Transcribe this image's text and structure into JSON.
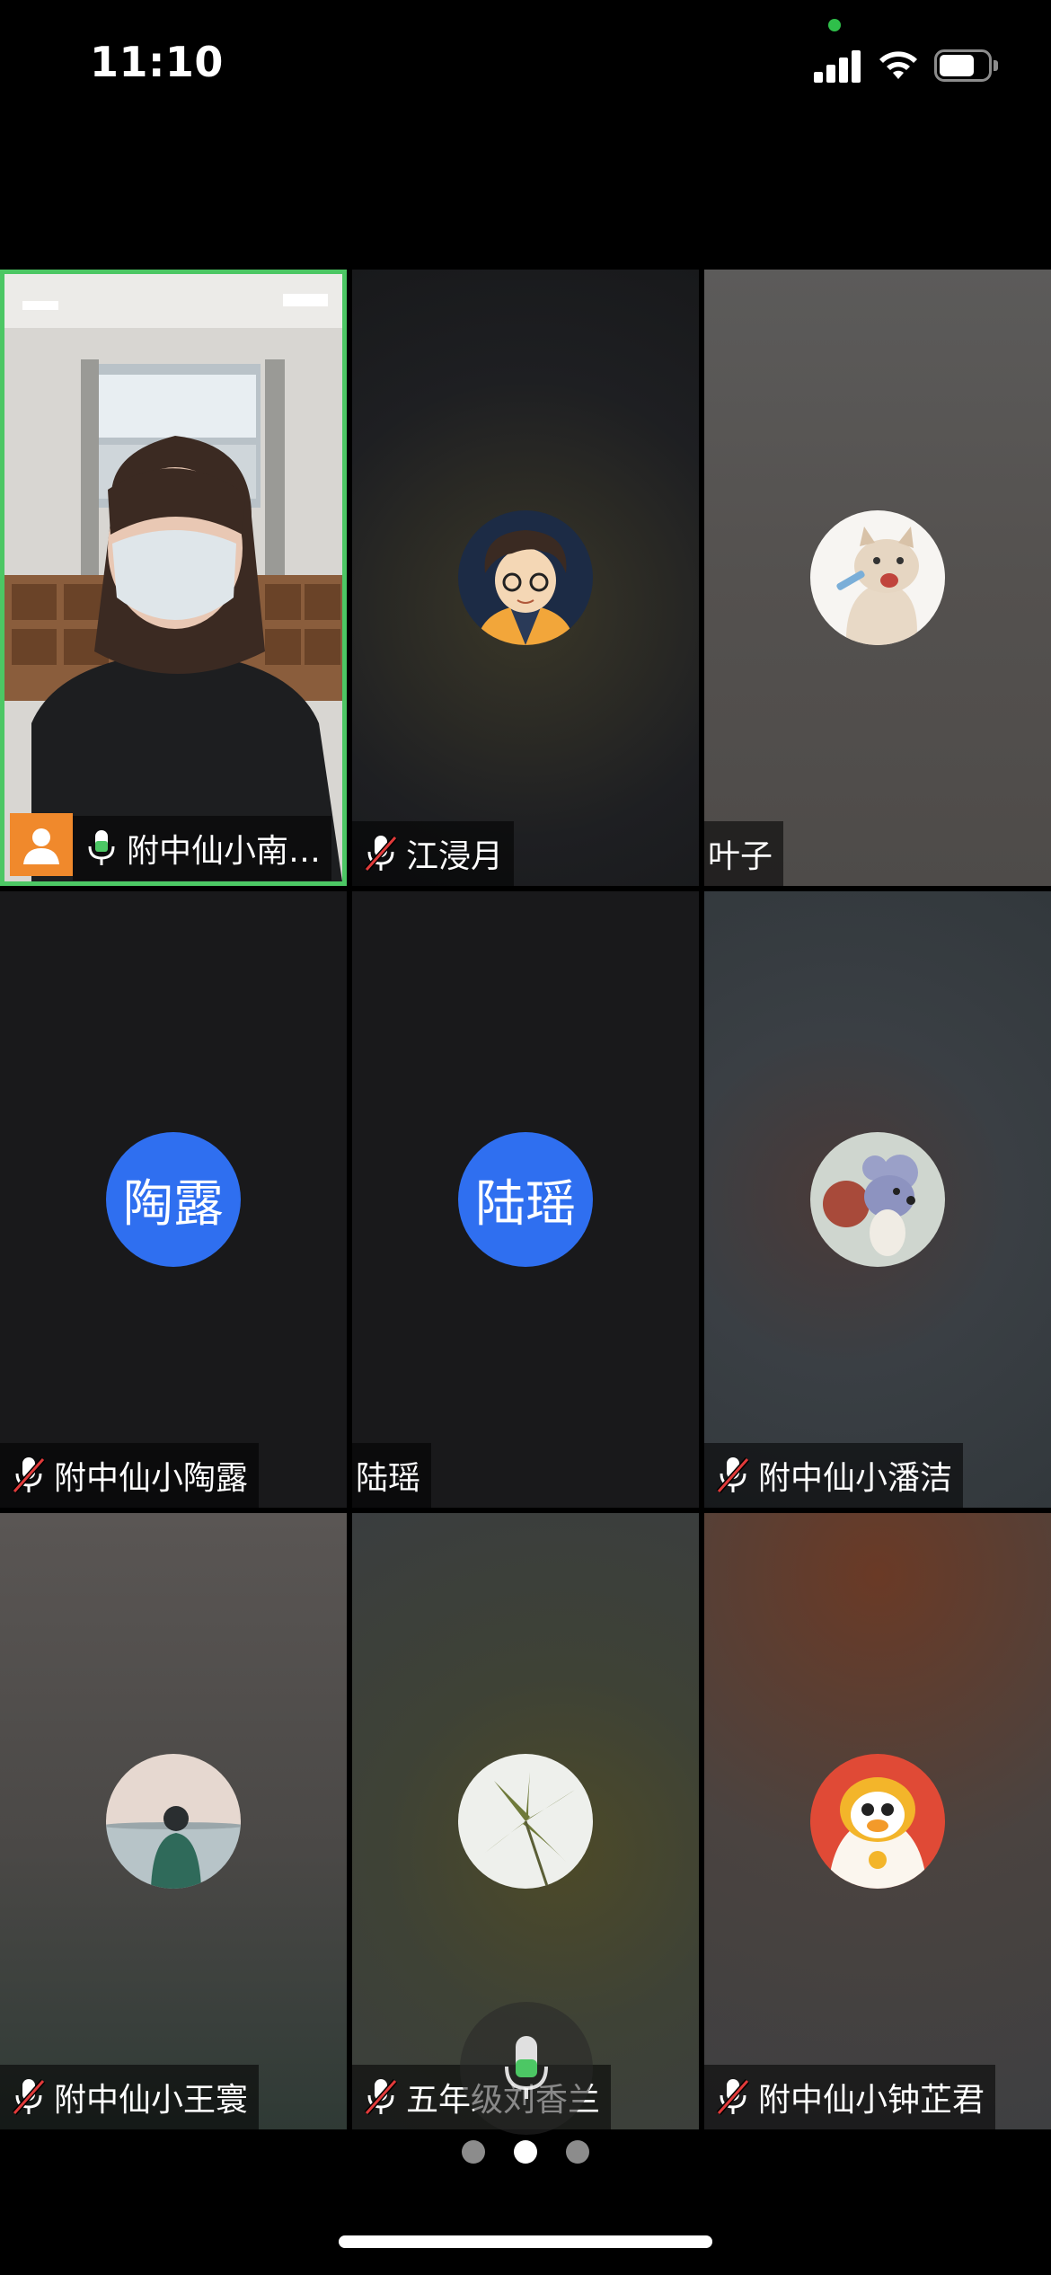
{
  "status_bar": {
    "time": "11:10",
    "signal_icon": "cellular-signal-icon",
    "wifi_icon": "wifi-icon",
    "battery_icon": "battery-icon",
    "camera_indicator_color": "#2fbf4a"
  },
  "participants": [
    {
      "name": "附中仙小南…",
      "mic": "on",
      "video": true,
      "active_speaker": true,
      "badge_icon": "person-icon"
    },
    {
      "name": "江浸月",
      "mic": "muted",
      "avatar": "cartoon-glasses-avatar"
    },
    {
      "name": "叶子",
      "mic": "none",
      "avatar": "cat-avatar"
    },
    {
      "name": "附中仙小陶露",
      "mic": "muted",
      "initials": "陶露"
    },
    {
      "name": "陆瑶",
      "mic": "none",
      "initials": "陆瑶"
    },
    {
      "name": "附中仙小潘洁",
      "mic": "muted",
      "avatar": "cartoon-mouse-avatar"
    },
    {
      "name": "附中仙小王寰",
      "mic": "muted",
      "avatar": "lake-photo-avatar"
    },
    {
      "name": "五年级刘香兰",
      "mic": "muted",
      "avatar": "bamboo-leaves-avatar"
    },
    {
      "name": "附中仙小钟芷君",
      "mic": "muted",
      "avatar": "tiger-duck-avatar"
    }
  ],
  "pager": {
    "pages": 3,
    "current": 2
  },
  "colors": {
    "active_border": "#4cc764",
    "initials_bg": "#2f6ff0",
    "badge_orange": "#f0892c",
    "mic_on": "#4cc764",
    "mic_muted_slash": "#e03a3a"
  }
}
